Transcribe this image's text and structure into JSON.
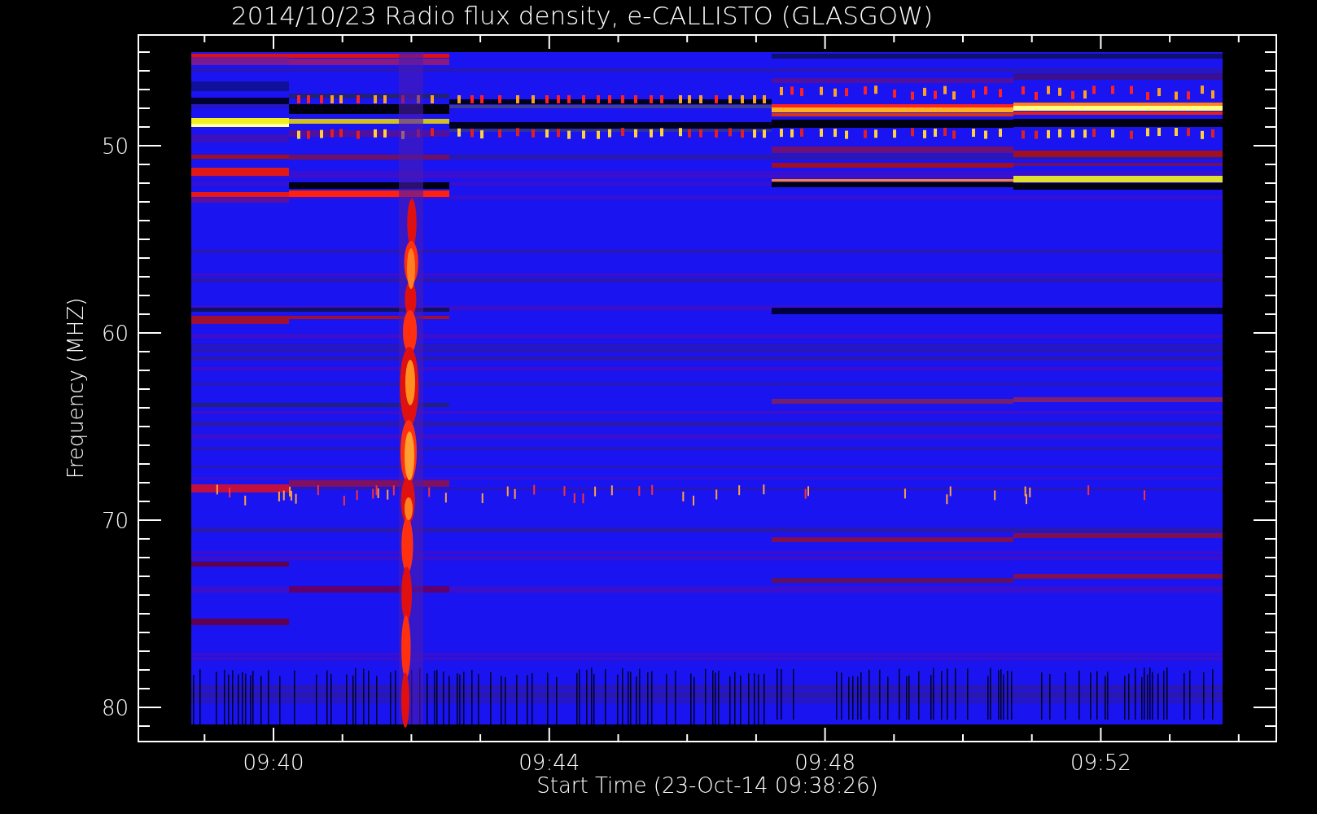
{
  "plot": {
    "title": "2014/10/23  Radio flux density, e-CALLISTO (GLASGOW)",
    "ylabel": "Frequency (MHZ)",
    "xlabel": "Start Time (23-Oct-14 09:38:26)",
    "yticks": [
      "50",
      "60",
      "70",
      "80"
    ],
    "xticks": [
      "09:40",
      "09:44",
      "09:48",
      "09:52"
    ]
  }
}
